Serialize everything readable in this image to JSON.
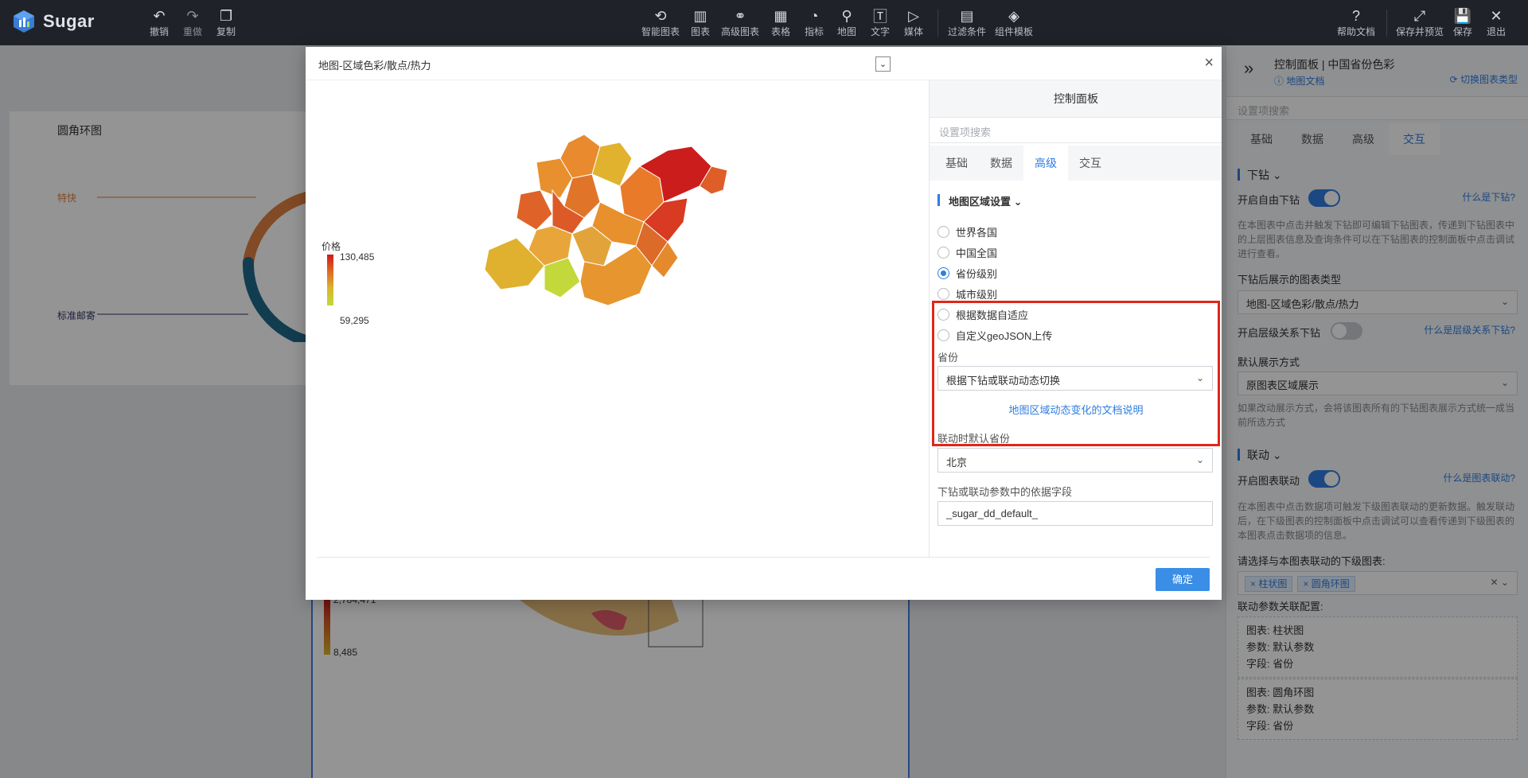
{
  "app": {
    "name": "Sugar"
  },
  "toolbar": {
    "left": [
      {
        "label": "撤销",
        "icon": "undo-icon"
      },
      {
        "label": "重做",
        "icon": "redo-icon"
      },
      {
        "label": "复制",
        "icon": "copy-icon"
      }
    ],
    "center": [
      {
        "label": "智能图表",
        "icon": "smart-chart-icon"
      },
      {
        "label": "图表",
        "icon": "chart-icon"
      },
      {
        "label": "高级图表",
        "icon": "advanced-chart-icon"
      },
      {
        "label": "表格",
        "icon": "table-icon"
      },
      {
        "label": "指标",
        "icon": "gauge-icon"
      },
      {
        "label": "地图",
        "icon": "map-icon"
      },
      {
        "label": "文字",
        "icon": "text-icon"
      },
      {
        "label": "媒体",
        "icon": "media-icon"
      },
      {
        "label": "过滤条件",
        "icon": "filter-icon"
      },
      {
        "label": "组件模板",
        "icon": "template-icon"
      }
    ],
    "right": [
      {
        "label": "帮助文档",
        "icon": "help-icon"
      },
      {
        "label": "保存并预览",
        "icon": "expand-icon"
      },
      {
        "label": "保存",
        "icon": "save-icon"
      },
      {
        "label": "退出",
        "icon": "close-icon"
      }
    ]
  },
  "canvas": {
    "card1_title": "圆角环图",
    "card1_labels": [
      "特快",
      "标准邮寄"
    ],
    "card2_legend": {
      "title": "价格",
      "max": "2,784,471",
      "min": "8,485"
    }
  },
  "right_panel": {
    "title": "控制面板 | 中国省份色彩",
    "doc_link": "地图文档",
    "switch_link": "切换图表类型",
    "search_placeholder": "设置项搜索",
    "tabs": [
      "基础",
      "数据",
      "高级",
      "交互"
    ],
    "active_tab": "交互",
    "drill_section": "下钻",
    "enable_free_drill": "开启自由下钻",
    "what_is_drill": "什么是下钻?",
    "drill_desc": "在本图表中点击并触发下钻即可编辑下钻图表，传递到下钻图表中的上层图表信息及查询条件可以在下钻图表的控制面板中点击调试进行查看。",
    "drill_chart_type_label": "下钻后展示的图表类型",
    "drill_chart_type_value": "地图-区域色彩/散点/热力",
    "enable_level_drill": "开启层级关系下钻",
    "what_is_level_drill": "什么是层级关系下钻?",
    "default_display_label": "默认展示方式",
    "default_display_value": "原图表区域展示",
    "default_display_desc": "如果改动展示方式，会将该图表所有的下钻图表展示方式统一成当前所选方式",
    "link_section": "联动",
    "enable_link": "开启图表联动",
    "what_is_link": "什么是图表联动?",
    "link_desc": "在本图表中点击数据项可触发下级图表联动的更新数据。触发联动后，在下级图表的控制面板中点击调试可以查看传递到下级图表的本图表点击数据项的信息。",
    "select_linked_label": "请选择与本图表联动的下级图表:",
    "linked_tags": [
      "柱状图",
      "圆角环图"
    ],
    "link_param_label": "联动参数关联配置:",
    "configs": [
      {
        "chart_label": "图表:",
        "chart": "柱状图",
        "param_label": "参数:",
        "param": "默认参数",
        "field_label": "字段:",
        "field": "省份"
      },
      {
        "chart_label": "图表:",
        "chart": "圆角环图",
        "param_label": "参数:",
        "param": "默认参数",
        "field_label": "字段:",
        "field": "省份"
      }
    ]
  },
  "modal": {
    "title": "地图-区域色彩/散点/热力",
    "ok": "确定",
    "legend": {
      "title": "价格",
      "max": "130,485",
      "min": "59,295"
    },
    "control_panel": {
      "header": "控制面板",
      "search_placeholder": "设置项搜索",
      "tabs": [
        "基础",
        "数据",
        "高级",
        "交互"
      ],
      "active_tab": "高级",
      "section": "地图区域设置",
      "radios": [
        {
          "label": "世界各国",
          "checked": false
        },
        {
          "label": "中国全国",
          "checked": false
        },
        {
          "label": "省份级别",
          "checked": true
        },
        {
          "label": "城市级别",
          "checked": false
        },
        {
          "label": "根据数据自适应",
          "checked": false
        },
        {
          "label": "自定义geoJSON上传",
          "checked": false
        }
      ],
      "province_label": "省份",
      "province_value": "根据下钻或联动动态切换",
      "doc_link": "地图区域动态变化的文档说明",
      "default_province_label": "联动时默认省份",
      "default_province_value": "北京",
      "field_label": "下钻或联动参数中的依据字段",
      "field_value": "_sugar_dd_default_"
    }
  },
  "colors": {
    "accent": "#2f7de1",
    "highlight_border": "#e0261a",
    "toolbar_bg": "#1f2329",
    "map_high": "#cc1a1a",
    "map_low": "#c3d83a"
  }
}
